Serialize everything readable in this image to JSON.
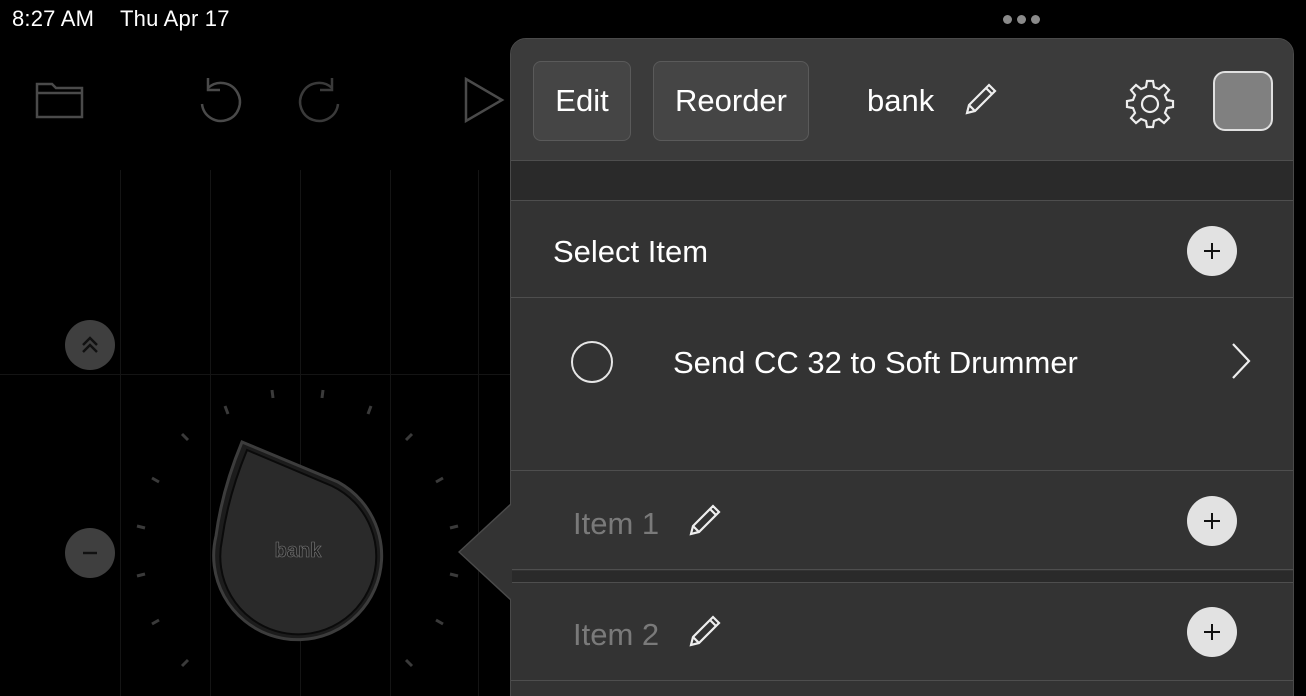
{
  "status_bar": {
    "time": "8:27 AM",
    "date": "Thu Apr 17"
  },
  "canvas": {
    "knob_label": "bank",
    "icons": [
      "folder-icon",
      "undo-icon",
      "redo-icon",
      "play-icon",
      "double-chevron-up-icon",
      "minus-icon"
    ]
  },
  "popover": {
    "edit_label": "Edit",
    "reorder_label": "Reorder",
    "title": "bank",
    "swatch_color": "#808080",
    "select_item_label": "Select Item",
    "selected_item": {
      "label": "Send CC 32 to Soft Drummer"
    },
    "items": [
      {
        "label": "Item 1"
      },
      {
        "label": "Item 2"
      }
    ]
  }
}
